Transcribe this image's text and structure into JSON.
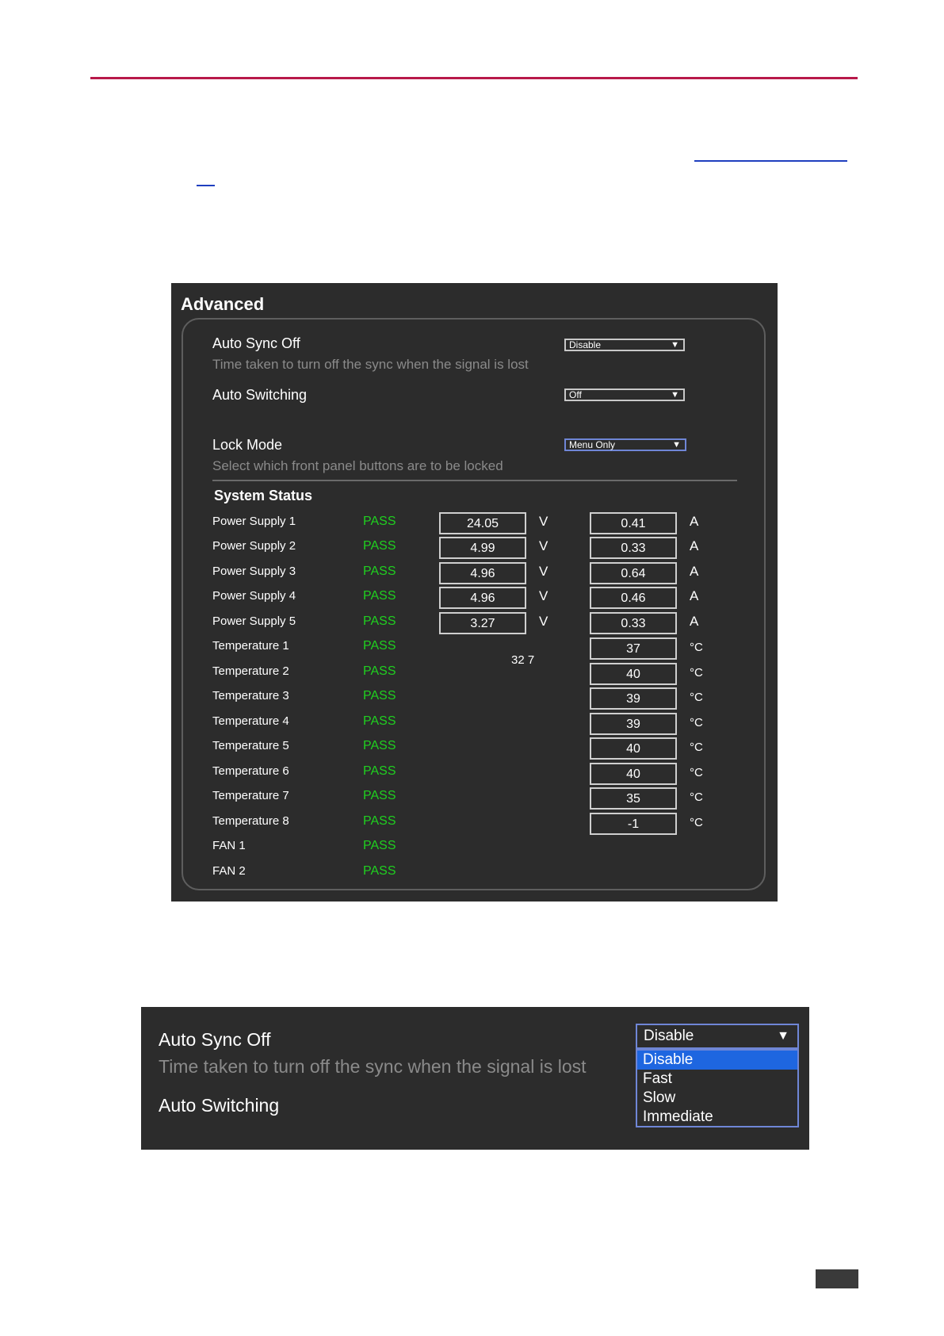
{
  "panel1": {
    "title": "Advanced",
    "auto_sync": {
      "label": "Auto Sync Off",
      "description": "Time taken to turn off the sync when the signal is lost",
      "value": "Disable"
    },
    "auto_switching": {
      "label": "Auto Switching",
      "value": "Off"
    },
    "lock_mode": {
      "label": "Lock Mode",
      "description": "Select which front panel buttons are to be locked",
      "value": "Menu Only"
    },
    "dropdown_arrow": "▼",
    "system_status": {
      "title": "System Status",
      "power": [
        {
          "label": "Power Supply 1",
          "status": "PASS",
          "voltage": "24.05",
          "voltage_unit": "V",
          "current": "0.41",
          "current_unit": "A"
        },
        {
          "label": "Power Supply 2",
          "status": "PASS",
          "voltage": "4.99",
          "voltage_unit": "V",
          "current": "0.33",
          "current_unit": "A"
        },
        {
          "label": "Power Supply 3",
          "status": "PASS",
          "voltage": "4.96",
          "voltage_unit": "V",
          "current": "0.64",
          "current_unit": "A"
        },
        {
          "label": "Power Supply 4",
          "status": "PASS",
          "voltage": "4.96",
          "voltage_unit": "V",
          "current": "0.46",
          "current_unit": "A"
        },
        {
          "label": "Power Supply 5",
          "status": "PASS",
          "voltage": "3.27",
          "voltage_unit": "V",
          "current": "0.33",
          "current_unit": "A"
        }
      ],
      "temperatures": [
        {
          "label": "Temperature 1",
          "status": "PASS",
          "value": "37",
          "unit": "°C"
        },
        {
          "label": "Temperature 2",
          "status": "PASS",
          "value": "40",
          "unit": "°C"
        },
        {
          "label": "Temperature 3",
          "status": "PASS",
          "value": "39",
          "unit": "°C"
        },
        {
          "label": "Temperature 4",
          "status": "PASS",
          "value": "39",
          "unit": "°C"
        },
        {
          "label": "Temperature 5",
          "status": "PASS",
          "value": "40",
          "unit": "°C"
        },
        {
          "label": "Temperature 6",
          "status": "PASS",
          "value": "40",
          "unit": "°C"
        },
        {
          "label": "Temperature 7",
          "status": "PASS",
          "value": "35",
          "unit": "°C"
        },
        {
          "label": "Temperature 8",
          "status": "PASS",
          "value": "-1",
          "unit": "°C"
        }
      ],
      "fans": [
        {
          "label": "FAN 1",
          "status": "PASS"
        },
        {
          "label": "FAN 2",
          "status": "PASS"
        }
      ],
      "overlay_text": "32 7"
    }
  },
  "panel2": {
    "auto_sync_label": "Auto Sync Off",
    "auto_sync_description": "Time taken to turn off the sync when the signal is lost",
    "auto_switching_label": "Auto Switching",
    "selected": "Disable",
    "arrow": "▼",
    "options": [
      "Disable",
      "Fast",
      "Slow",
      "Immediate"
    ]
  }
}
